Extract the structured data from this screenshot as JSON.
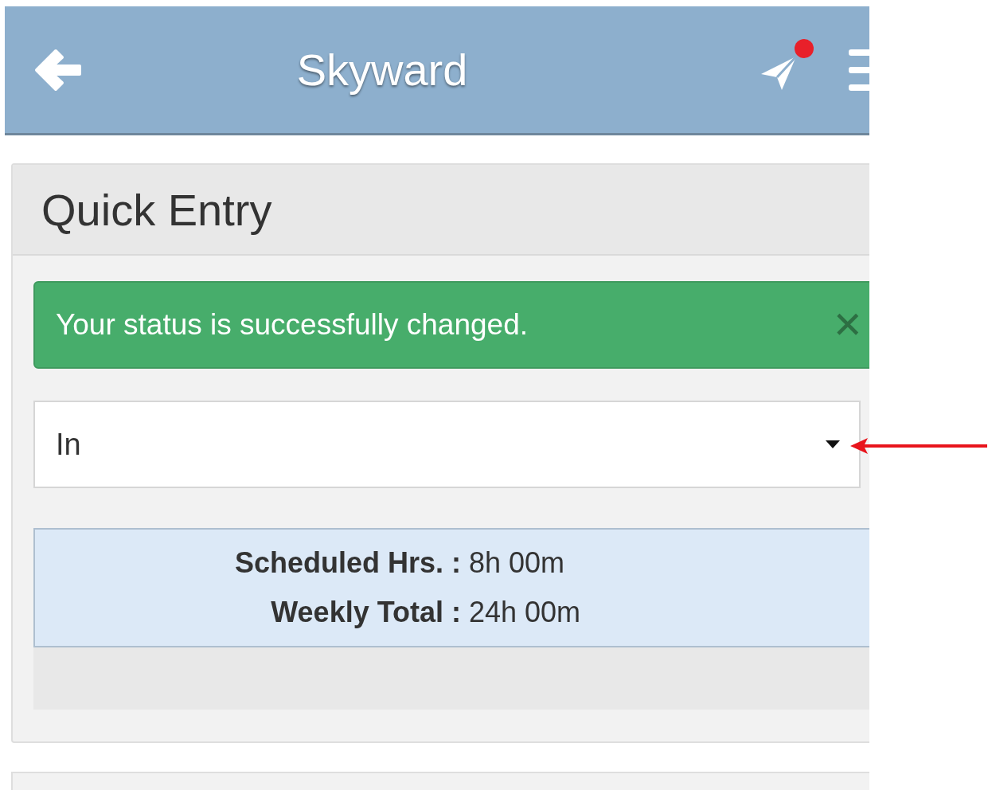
{
  "header": {
    "title": "Skyward",
    "unread": true
  },
  "panel": {
    "title": "Quick Entry"
  },
  "alert": {
    "message": "Your status is successfully changed.",
    "close": "✕"
  },
  "status_select": {
    "value": "In"
  },
  "summary": [
    {
      "label": "Scheduled Hrs. :",
      "value": "8h 00m"
    },
    {
      "label": "Weekly Total :",
      "value": "24h 00m"
    }
  ],
  "annotations": [
    {
      "kind": "arrow"
    }
  ]
}
